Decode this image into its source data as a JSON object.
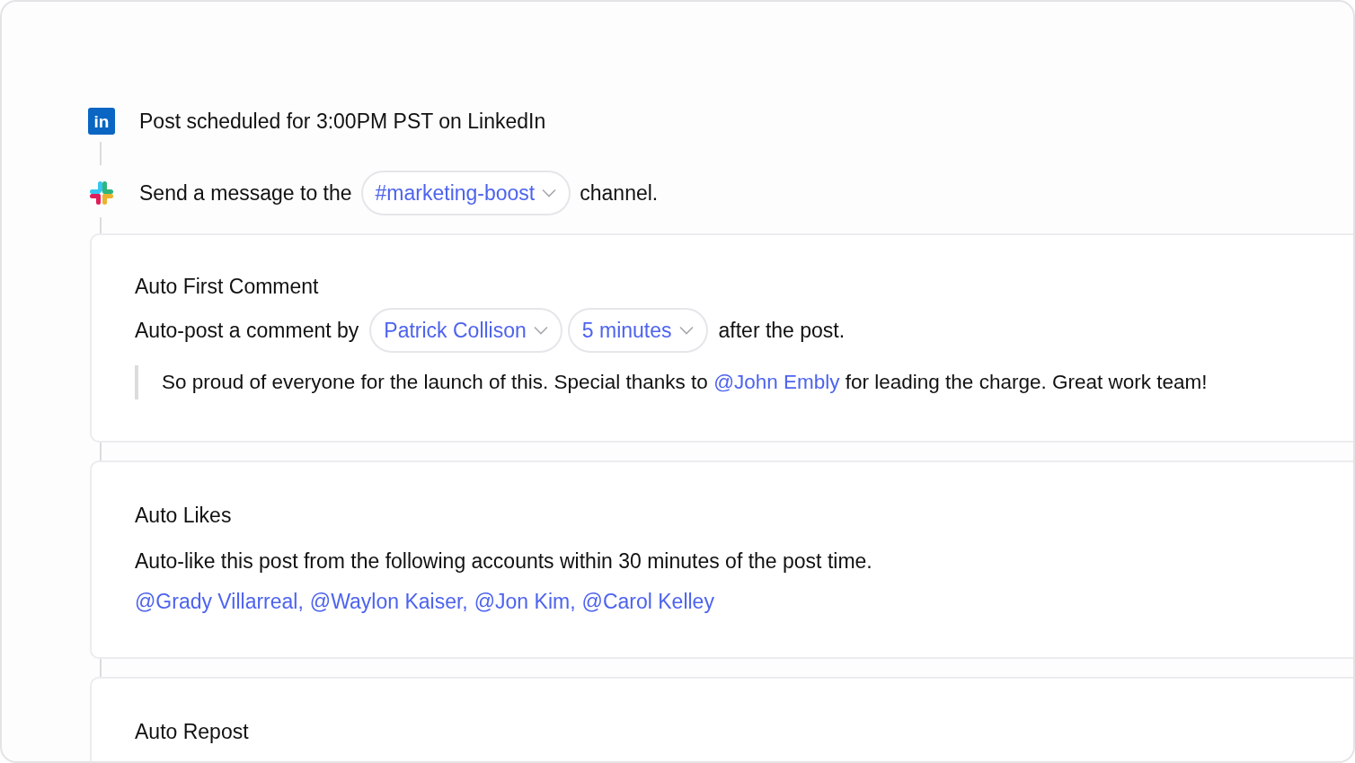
{
  "steps": [
    {
      "kind": "linkedin",
      "logo_text": "in",
      "text": "Post scheduled for 3:00PM PST on LinkedIn"
    },
    {
      "kind": "slack",
      "before": "Send a message to the",
      "dropdown": "#marketing-boost",
      "after": "channel."
    }
  ],
  "cards": [
    {
      "kind": "comment",
      "title": "Auto First Comment",
      "before": "Auto-post a comment by",
      "dropdowns": [
        "Patrick Collison",
        "5 minutes"
      ],
      "after": "after the post.",
      "quote": {
        "before": "So proud of everyone for the launch of this. Special thanks to",
        "mention": "@John Embly",
        "after": "for leading the charge. Great work team!"
      }
    },
    {
      "kind": "likes",
      "title": "Auto Likes",
      "text": "Auto-like this post from the following accounts within 30 minutes of the post time.",
      "mentions": [
        "@Grady Villarreal,",
        "@Waylon Kaiser,",
        "@Jon Kim,",
        "@Carol Kelley"
      ]
    },
    {
      "kind": "repost",
      "title": "Auto Repost"
    }
  ]
}
